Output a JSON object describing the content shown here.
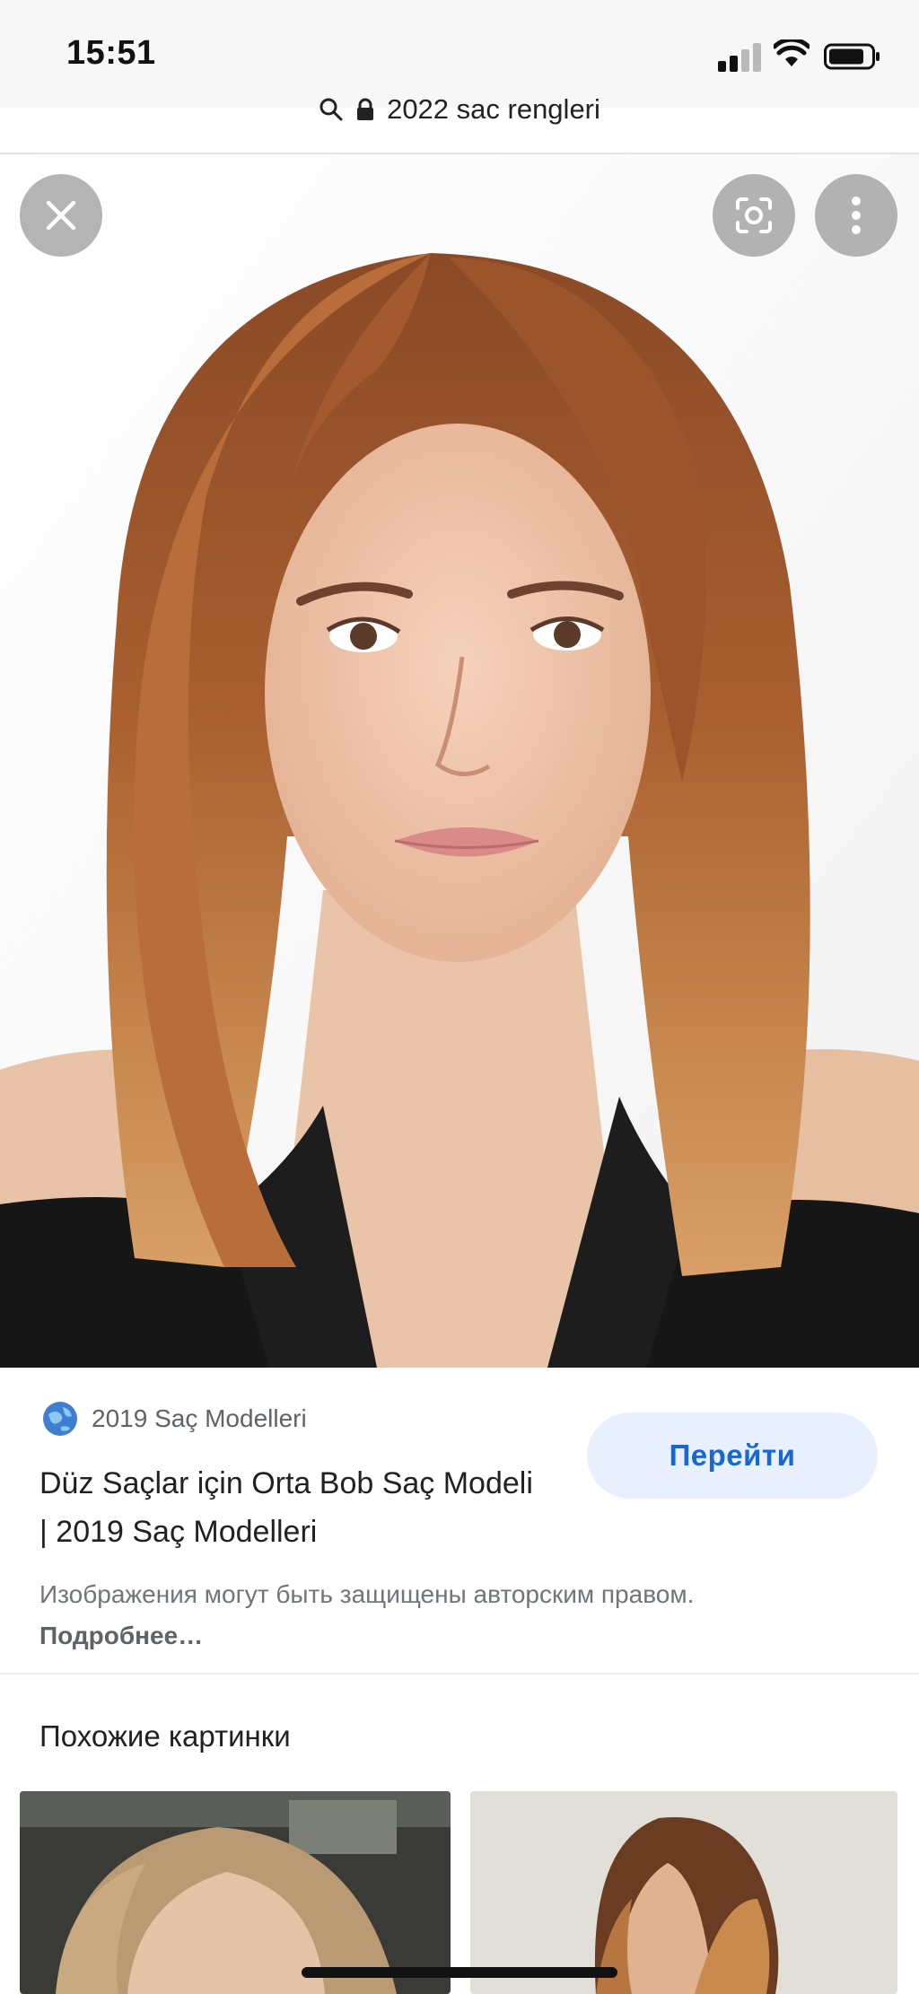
{
  "status_bar": {
    "time": "15:51"
  },
  "address_bar": {
    "query": "2022 sac rengleri"
  },
  "viewer": {
    "close_icon": "close-icon",
    "lens_icon": "google-lens-icon",
    "more_icon": "more-vert-icon"
  },
  "result": {
    "source_name": "2019 Saç Modelleri",
    "title": "Düz Saçlar için Orta Bob Saç Modeli | 2019 Saç Modelleri",
    "visit_label": "Перейти",
    "copyright_text": "Изображения могут быть защищены авторским правом.",
    "more_link": "Подробнее…"
  },
  "related": {
    "heading": "Похожие картинки"
  },
  "colors": {
    "accent": "#1967d2",
    "button_bg": "#e8f0fe",
    "hair": "#b06a3a",
    "status_bg": "#f7f7f7"
  }
}
